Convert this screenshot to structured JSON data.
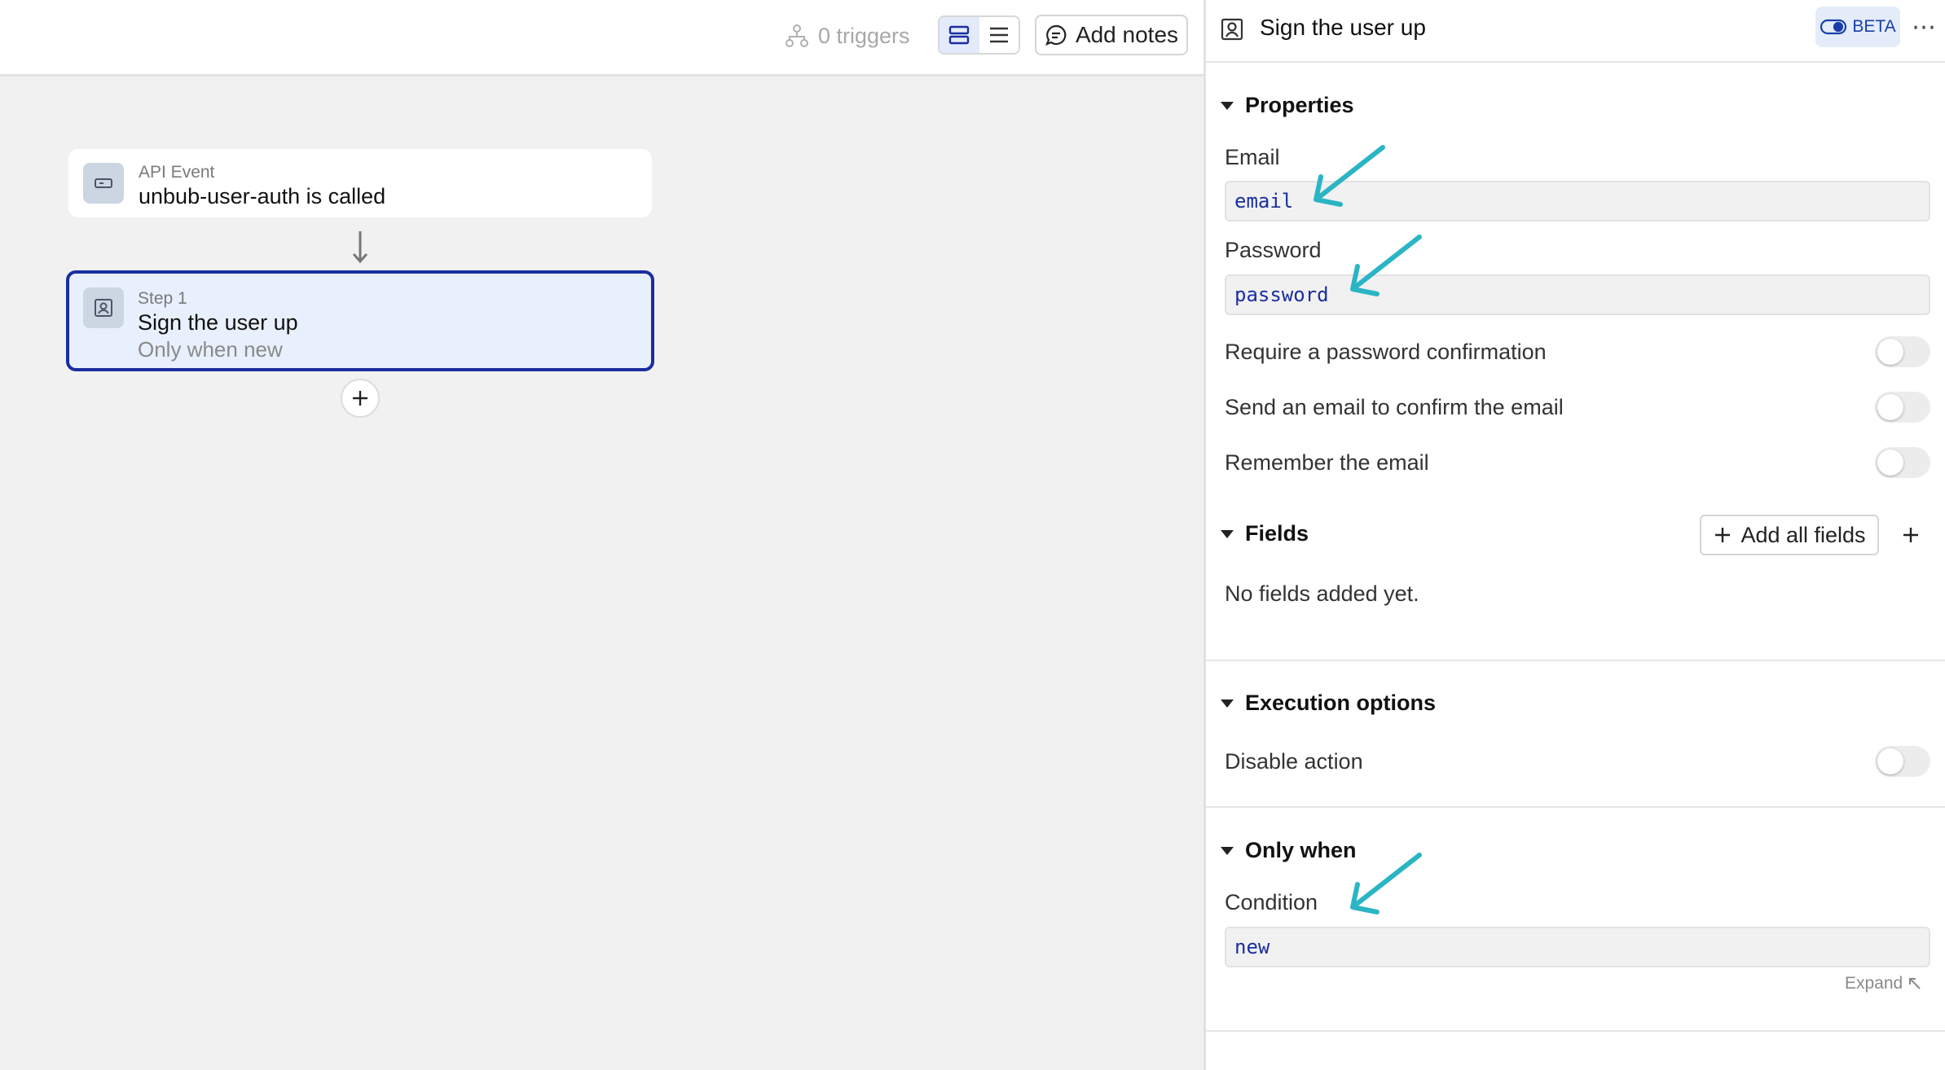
{
  "toolbar": {
    "triggers_label": "0 triggers",
    "add_notes_label": "Add notes"
  },
  "canvas": {
    "trigger_node": {
      "subtitle": "API Event",
      "title": "unbub-user-auth is called"
    },
    "step_node": {
      "subtitle": "Step 1",
      "title": "Sign the user up",
      "note": "Only when new"
    }
  },
  "panel": {
    "title": "Sign the user up",
    "beta_label": "BETA",
    "more_label": "⋯",
    "properties": {
      "title": "Properties",
      "email_label": "Email",
      "email_value": "email",
      "password_label": "Password",
      "password_value": "password",
      "toggles": [
        {
          "label": "Require a password confirmation",
          "on": false
        },
        {
          "label": "Send an email to confirm the email",
          "on": false
        },
        {
          "label": "Remember the email",
          "on": false
        }
      ]
    },
    "fields": {
      "title": "Fields",
      "add_all_label": "Add all fields",
      "empty_text": "No fields added yet."
    },
    "execution": {
      "title": "Execution options",
      "disable_label": "Disable action",
      "disable_on": false
    },
    "only_when": {
      "title": "Only when",
      "condition_label": "Condition",
      "condition_value": "new",
      "expand_label": "Expand"
    }
  },
  "colors": {
    "accent": "#1a2ea0",
    "annotation_arrow": "#2bb5c4",
    "selected_node_bg": "#e8f0fd"
  }
}
